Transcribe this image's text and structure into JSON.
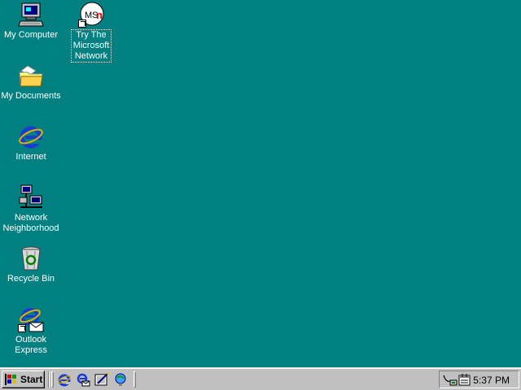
{
  "desktop": {
    "background": "#008080",
    "icons": [
      {
        "label": "My Computer",
        "icon": "computer-icon"
      },
      {
        "label": "My Documents",
        "icon": "folder-icon"
      },
      {
        "label": "Internet",
        "icon": "internet-explorer-icon"
      },
      {
        "label": "Network Neighborhood",
        "icon": "network-icon"
      },
      {
        "label": "Recycle Bin",
        "icon": "recycle-bin-icon"
      },
      {
        "label": "Outlook Express",
        "icon": "outlook-express-icon"
      },
      {
        "label": "Try The Microsoft Network",
        "icon": "msn-icon",
        "focused": true
      }
    ]
  },
  "taskbar": {
    "start_label": "Start",
    "quick_launch": [
      "internet-explorer-icon",
      "outlook-express-icon",
      "show-desktop-icon",
      "channels-icon"
    ],
    "tray_icons": [
      "network-tray-icon",
      "scheduler-tray-icon"
    ],
    "clock": "5:37 PM"
  }
}
